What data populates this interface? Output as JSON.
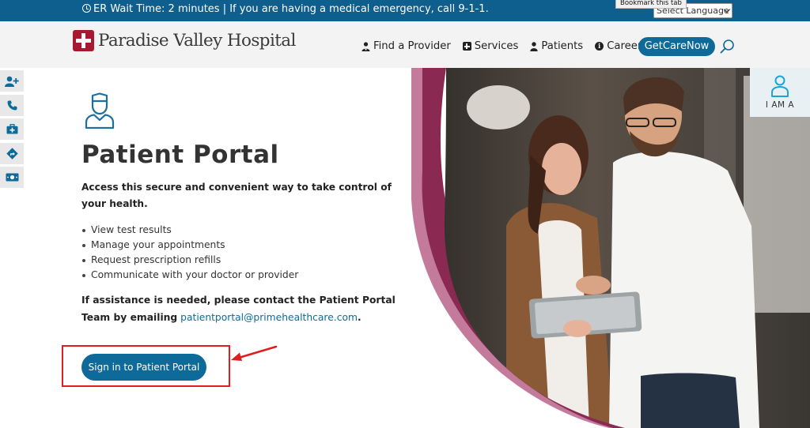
{
  "topbar": {
    "alert_text": "ER Wait Time: 2 minutes | If you are having a medical emergency, call 9-1-1.",
    "language_select": "Select Language",
    "tooltip": "Bookmark this tab",
    "background_color": "#0e5e8e"
  },
  "header": {
    "logo_text": "Paradise Valley Hospital",
    "logo_color": "#a6192e",
    "nav": [
      {
        "label": "Find a Provider",
        "icon": "doctor-icon"
      },
      {
        "label": "Services",
        "icon": "plus-square-icon"
      },
      {
        "label": "Patients",
        "icon": "person-icon"
      },
      {
        "label": "Careers",
        "icon": "info-icon"
      }
    ],
    "cta_label": "GetCareNow",
    "search_icon": "search-icon"
  },
  "sidebar": {
    "items": [
      {
        "icon": "add-user-icon"
      },
      {
        "icon": "phone-icon"
      },
      {
        "icon": "medical-kit-icon"
      },
      {
        "icon": "directions-icon"
      },
      {
        "icon": "money-bill-icon"
      }
    ]
  },
  "main": {
    "title": "Patient Portal",
    "intro": "Access this secure and convenient way to take control of your health.",
    "bullets": [
      "View test results",
      "Manage your appointments",
      "Request prescription refills",
      "Communicate with your doctor or provider"
    ],
    "assist_text": "If assistance is needed, please contact the Patient Portal Team by emailing",
    "assist_email": "patientportal@primehealthcare.com",
    "assist_end": ".",
    "signin_label": "Sign in to Patient Portal",
    "accent_color": "#0e6a99",
    "highlight_color": "#dd1f1f"
  },
  "iam": {
    "label": "I AM A"
  }
}
